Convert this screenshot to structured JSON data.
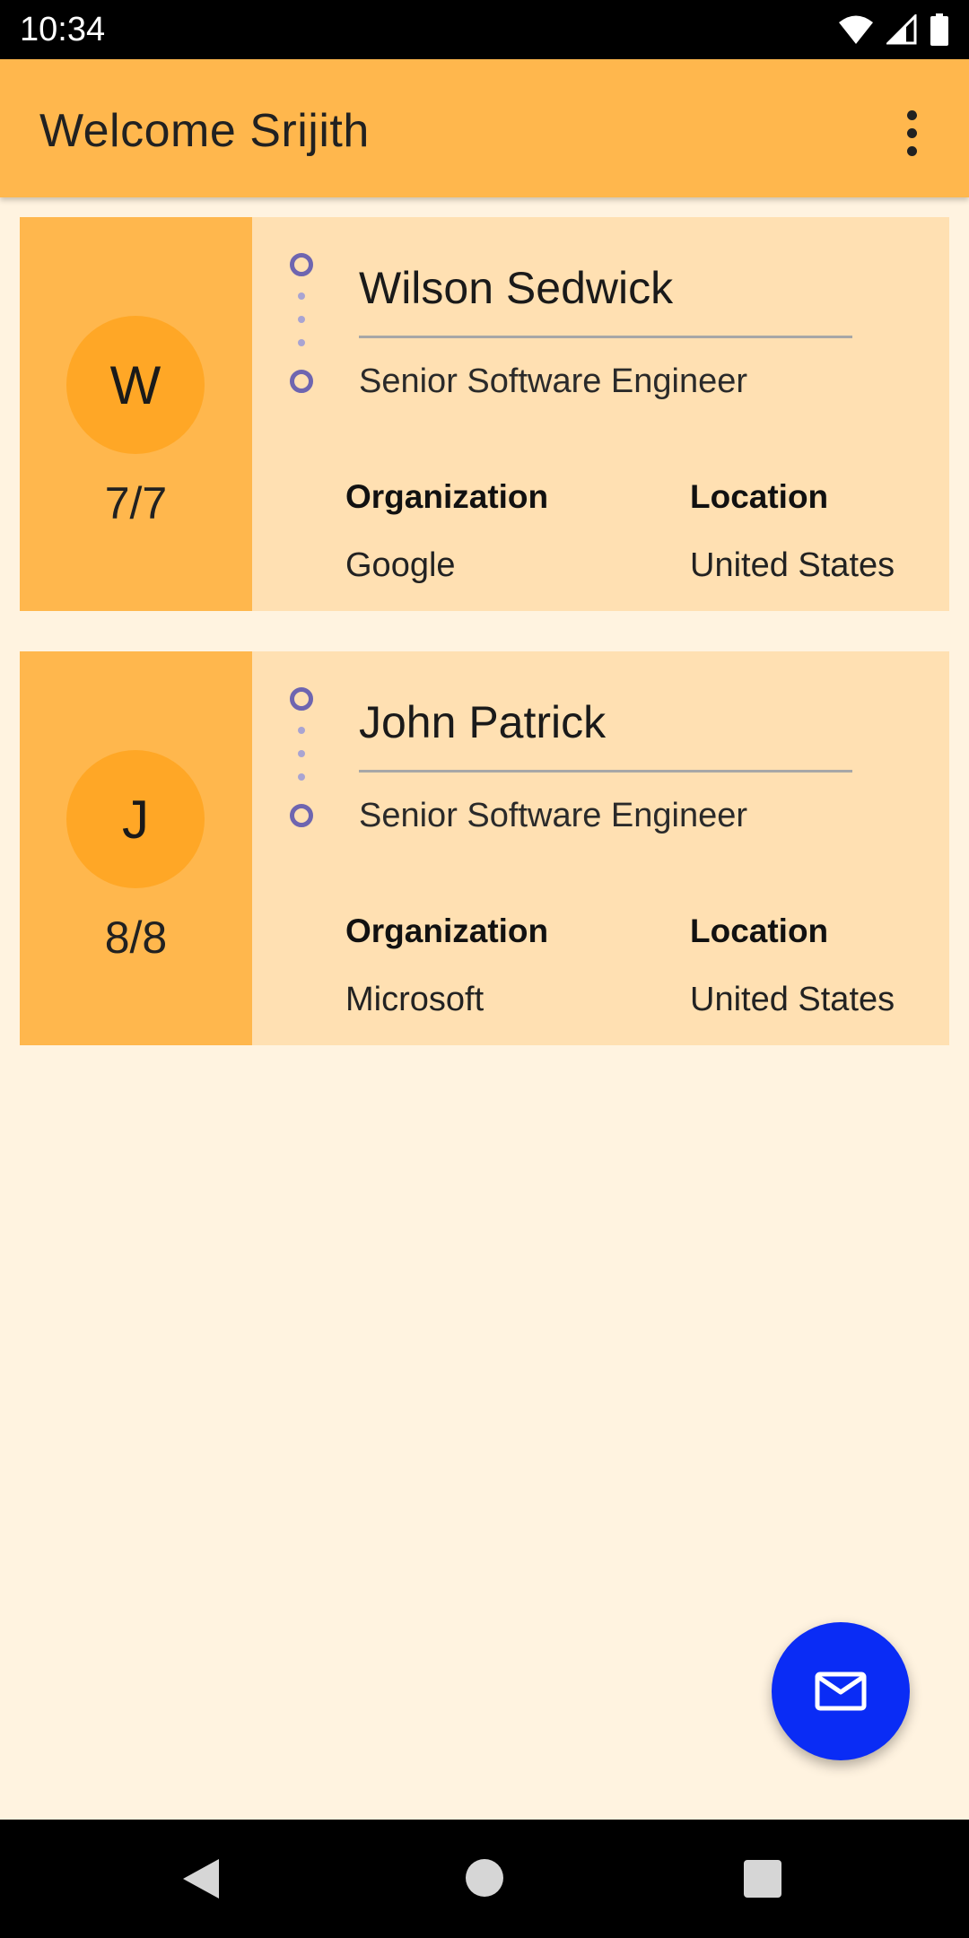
{
  "status_bar": {
    "time": "10:34",
    "icons": [
      "wifi-icon",
      "signal-icon",
      "battery-icon"
    ]
  },
  "app_bar": {
    "title": "Welcome Srijith",
    "menu_icon": "more-vert-icon"
  },
  "profiles": [
    {
      "initial": "W",
      "score": "7/7",
      "name": "Wilson Sedwick",
      "role": "Senior Software Engineer",
      "organization_label": "Organization",
      "organization": "Google",
      "location_label": "Location",
      "location": "United States"
    },
    {
      "initial": "J",
      "score": "8/8",
      "name": "John Patrick",
      "role": "Senior Software Engineer",
      "organization_label": "Organization",
      "organization": "Microsoft",
      "location_label": "Location",
      "location": "United States"
    }
  ],
  "fab": {
    "icon": "mail-icon"
  },
  "nav_bar": {
    "icons": [
      "back-icon",
      "home-icon",
      "recents-icon"
    ]
  },
  "colors": {
    "app_bar": "#ffb74d",
    "background": "#fff3e0",
    "card": "#ffe0b2",
    "avatar": "#ffa726",
    "timeline": "#6e65b0",
    "fab": "#0a2cf5"
  }
}
